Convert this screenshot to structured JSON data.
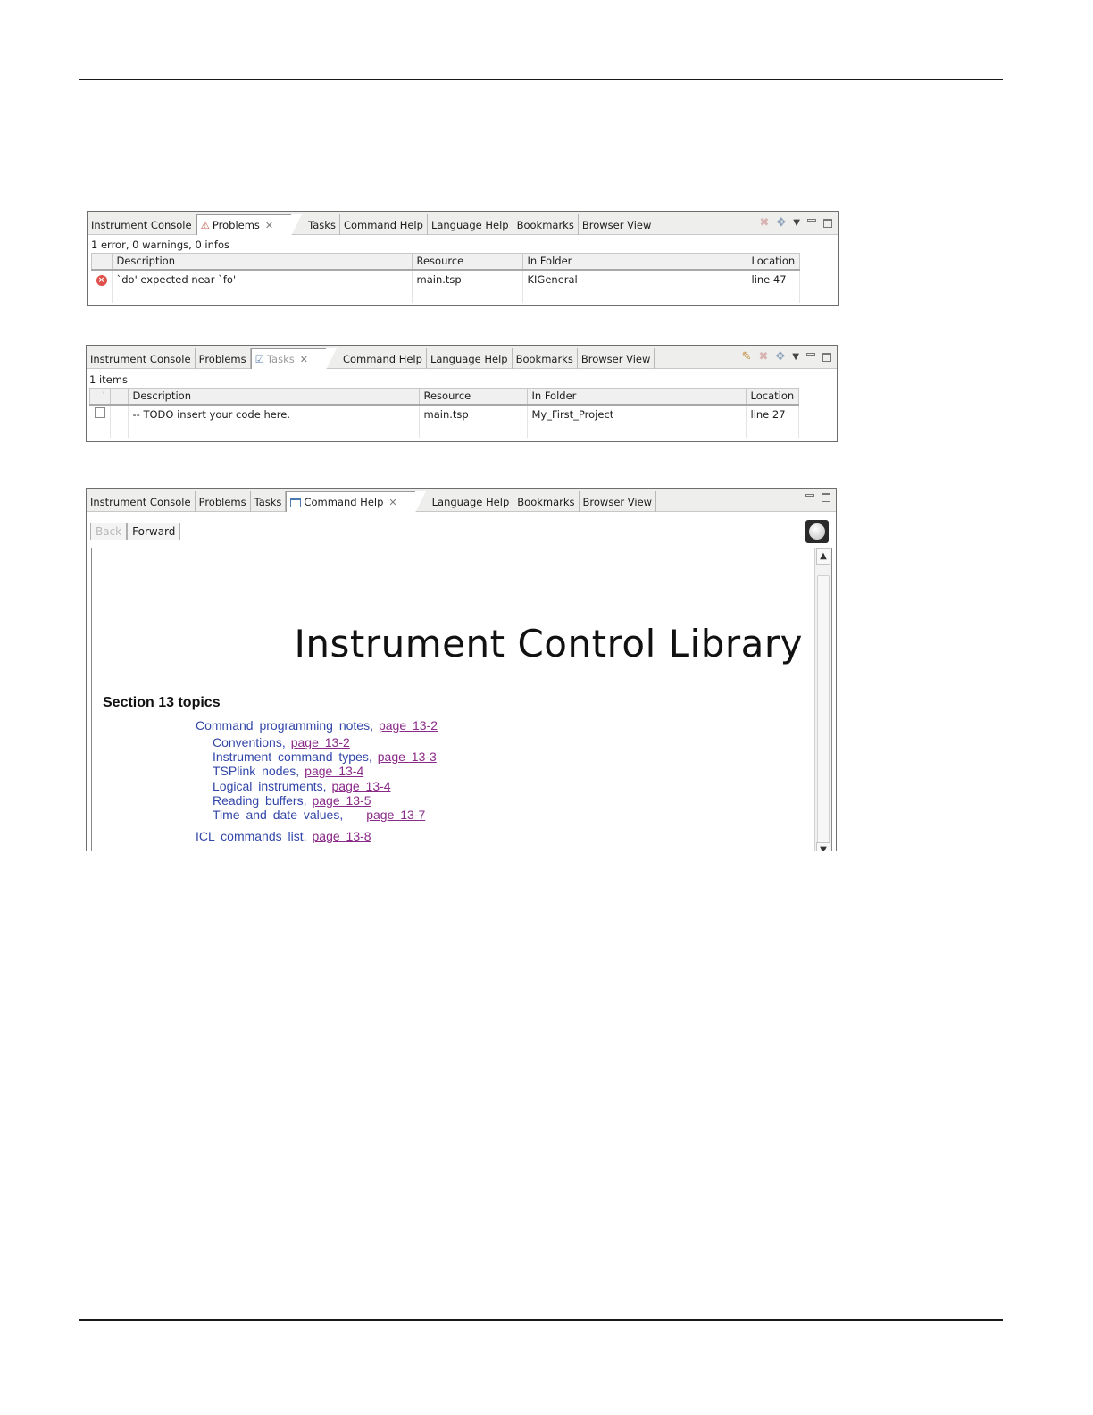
{
  "tabs_common": {
    "instrument_console": "Instrument Console",
    "problems": "Problems",
    "tasks": "Tasks",
    "command_help": "Command Help",
    "language_help": "Language Help",
    "bookmarks": "Bookmarks",
    "browser_view": "Browser View"
  },
  "problems_panel": {
    "summary": "1 error, 0 warnings, 0 infos",
    "columns": [
      "Description",
      "Resource",
      "In Folder",
      "Location"
    ],
    "rows": [
      {
        "description": "`do' expected near `fo'",
        "resource": "main.tsp",
        "folder": "KIGeneral",
        "location": "line 47"
      }
    ]
  },
  "tasks_panel": {
    "summary": "1 items",
    "sort_marker": "'",
    "columns": [
      "Description",
      "Resource",
      "In Folder",
      "Location"
    ],
    "rows": [
      {
        "description": "-- TODO insert your code here.",
        "resource": "main.tsp",
        "folder": "My_First_Project",
        "location": "line 27"
      }
    ]
  },
  "help_panel": {
    "back_label": "Back",
    "forward_label": "Forward",
    "doc_title": "Instrument Control Library",
    "section_heading": "Section 13 topics",
    "toc": [
      {
        "text": "Command programming notes,",
        "link": "page 13-2",
        "level": 1
      },
      {
        "text": "Conventions,",
        "link": "page 13-2",
        "level": 2
      },
      {
        "text": "Instrument command types,",
        "link": "page 13-3",
        "level": 2
      },
      {
        "text": "TSPlink nodes,",
        "link": "page 13-4",
        "level": 2
      },
      {
        "text": "Logical instruments,",
        "link": "page 13-4",
        "level": 2
      },
      {
        "text": "Reading buffers,",
        "link": "page 13-5",
        "level": 2
      },
      {
        "text": "Time and date values,",
        "link": "page 13-7",
        "level": 2
      },
      {
        "text": "ICL commands list,",
        "link": "page 13-8",
        "level": 1
      }
    ]
  },
  "icons": {
    "close": "close-icon",
    "error": "error-icon",
    "remove_all": "remove-icon",
    "filter": "filter-icon",
    "view_menu": "view-menu-icon",
    "minimize": "minimize-icon",
    "maximize": "maximize-icon",
    "add_task": "add-task-icon",
    "globe": "globe-icon"
  },
  "colors": {
    "link": "#8a2a88",
    "toc_text": "#3246a8",
    "error": "#e0504a"
  }
}
